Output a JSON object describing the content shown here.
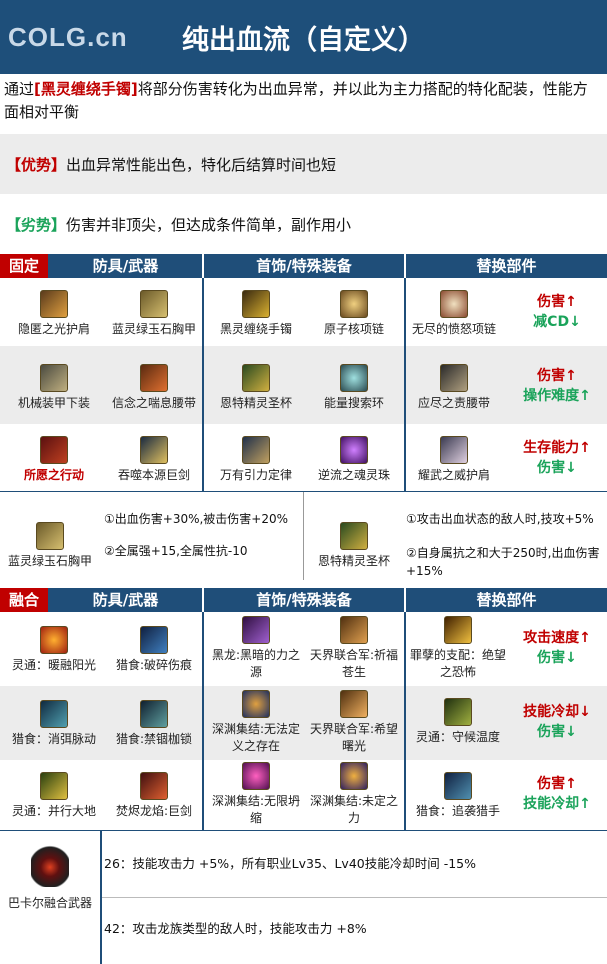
{
  "header": {
    "logo": "COLG.cn",
    "title": "纯出血流（自定义）"
  },
  "intro": {
    "p1": "通过",
    "item": "[黑灵缠绕手镯]",
    "p2": "将部分伤害转化为出血异常，并以此为主力搭配的特化配装，性能方面相对平衡"
  },
  "pros": {
    "tag": "【优势】",
    "text": "出血异常性能出色，特化后结算时间也短"
  },
  "cons": {
    "tag": "【劣势】",
    "text": "伤害并非顶尖，但达成条件简单，副作用小"
  },
  "fixed": {
    "tag": "固定",
    "cols": [
      "防具/武器",
      "首饰/特殊装备",
      "替换部件"
    ],
    "rows": [
      {
        "armor": [
          "隐匿之光护肩",
          "蓝灵绿玉石胸甲"
        ],
        "acc": [
          "黑灵缠绕手镯",
          "原子核项链"
        ],
        "swap": "无尽的愤怒项链",
        "up": "伤害↑",
        "down": "减CD↓"
      },
      {
        "armor": [
          "机械装甲下装",
          "信念之喘息腰带"
        ],
        "acc": [
          "恩特精灵圣杯",
          "能量搜索环"
        ],
        "swap": "应尽之责腰带",
        "up": "伤害↑",
        "down": "操作难度↑"
      },
      {
        "armor": [
          "所愿之行动",
          "吞噬本源巨剑"
        ],
        "acc": [
          "万有引力定律",
          "逆流之魂灵珠"
        ],
        "swap": "耀武之威护肩",
        "up": "生存能力↑",
        "down": "伤害↓"
      }
    ],
    "box1": {
      "name": "蓝灵绿玉石胸甲",
      "fx1": "①出血伤害+30%,被击伤害+20%",
      "fx2": "②全属强+15,全属性抗-10"
    },
    "box2": {
      "name": "恩特精灵圣杯",
      "fx1": "①攻击出血状态的敌人时,技攻+5%",
      "fx2": "②自身属抗之和大于250时,出血伤害",
      "fx3": "+15%"
    }
  },
  "fusion": {
    "tag": "融合",
    "cols": [
      "防具/武器",
      "首饰/特殊装备",
      "替换部件"
    ],
    "rows": [
      {
        "armor": [
          "灵通：暖融阳光",
          "猎食:破碎伤痕"
        ],
        "acc": [
          "黑龙:黑暗的力之",
          "源",
          "天界联合军:祈福",
          "苍生"
        ],
        "swap": [
          "罪孽的支配：绝望",
          "之恐怖"
        ],
        "up": "攻击速度↑",
        "down": "伤害↓"
      },
      {
        "armor": [
          "猎食：消弭脉动",
          "猎食:禁锢枷锁"
        ],
        "acc": [
          "深渊集结:无法定",
          "义之存在",
          "天界联合军:希望",
          "曙光"
        ],
        "swap": [
          "灵通：守候温度",
          ""
        ],
        "up": "技能冷却↓",
        "down": "伤害↓"
      },
      {
        "armor": [
          "灵通：并行大地",
          "焚烬龙焰:巨剑"
        ],
        "acc": [
          "深渊集结:无限坍",
          "缩",
          "深渊集结:未定之",
          "力"
        ],
        "swap": [
          "猎食：追袭猎手",
          ""
        ],
        "up": "伤害↑",
        "down": "技能冷却↑"
      }
    ],
    "weapon": {
      "name": "巴卡尔融合武器",
      "fx1": "26：技能攻击力 +5%，所有职业Lv35、Lv40技能冷却时间 -15%",
      "fx2": "42：攻击龙族类型的敌人时，技能攻击力 +8%"
    }
  },
  "colors": {
    "navy": "#1f4e79",
    "red": "#c00000",
    "green": "#1aa35a",
    "gray": "#ececec"
  }
}
